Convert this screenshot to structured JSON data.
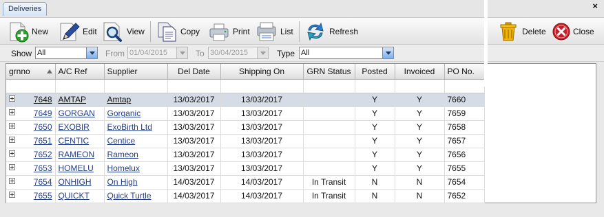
{
  "tab": {
    "label": "Deliveries",
    "close": "×"
  },
  "toolbar": {
    "new_label": "New",
    "edit_label": "Edit",
    "view_label": "View",
    "copy_label": "Copy",
    "print_label": "Print",
    "list_label": "List",
    "refresh_label": "Refresh",
    "delete_label": "Delete",
    "close_label": "Close"
  },
  "filters": {
    "show_label": "Show",
    "show_value": "All",
    "from_label": "From",
    "from_value": "01/04/2015",
    "to_label": "To",
    "to_value": "30/04/2015",
    "type_label": "Type",
    "type_value": "All"
  },
  "grid": {
    "columns": {
      "grnno": "grnno",
      "ac_ref": "A/C Ref",
      "supplier": "Supplier",
      "del_date": "Del Date",
      "shipping_on": "Shipping On",
      "grn_status": "GRN Status",
      "posted": "Posted",
      "invoiced": "Invoiced",
      "po_no": "PO No."
    },
    "rows": [
      {
        "grnno": "7648",
        "ac_ref": "AMTAP",
        "supplier": "Amtap",
        "del_date": "13/03/2017",
        "shipping_on": "13/03/2017",
        "grn_status": "",
        "posted": "Y",
        "invoiced": "Y",
        "po_no": "7660"
      },
      {
        "grnno": "7649",
        "ac_ref": "GORGAN",
        "supplier": "Gorganic",
        "del_date": "13/03/2017",
        "shipping_on": "13/03/2017",
        "grn_status": "",
        "posted": "Y",
        "invoiced": "Y",
        "po_no": "7659"
      },
      {
        "grnno": "7650",
        "ac_ref": "EXOBIR",
        "supplier": "ExoBirth Ltd",
        "del_date": "13/03/2017",
        "shipping_on": "13/03/2017",
        "grn_status": "",
        "posted": "Y",
        "invoiced": "Y",
        "po_no": "7658"
      },
      {
        "grnno": "7651",
        "ac_ref": "CENTIC",
        "supplier": "Centice",
        "del_date": "13/03/2017",
        "shipping_on": "13/03/2017",
        "grn_status": "",
        "posted": "Y",
        "invoiced": "Y",
        "po_no": "7657"
      },
      {
        "grnno": "7652",
        "ac_ref": "RAMEON",
        "supplier": "Rameon",
        "del_date": "13/03/2017",
        "shipping_on": "13/03/2017",
        "grn_status": "",
        "posted": "Y",
        "invoiced": "Y",
        "po_no": "7656"
      },
      {
        "grnno": "7653",
        "ac_ref": "HOMELU",
        "supplier": "Homelux",
        "del_date": "13/03/2017",
        "shipping_on": "13/03/2017",
        "grn_status": "",
        "posted": "Y",
        "invoiced": "Y",
        "po_no": "7655"
      },
      {
        "grnno": "7654",
        "ac_ref": "ONHIGH",
        "supplier": "On High",
        "del_date": "14/03/2017",
        "shipping_on": "14/03/2017",
        "grn_status": "In Transit",
        "posted": "N",
        "invoiced": "N",
        "po_no": "7654"
      },
      {
        "grnno": "7655",
        "ac_ref": "QUICKT",
        "supplier": "Quick Turtle",
        "del_date": "14/03/2017",
        "shipping_on": "14/03/2017",
        "grn_status": "In Transit",
        "posted": "N",
        "invoiced": "N",
        "po_no": "7652"
      }
    ]
  },
  "colors": {
    "selected_row": "#d6dce6",
    "link": "#233e8a",
    "combo_button": "#7faee8",
    "close_icon": "#c8202a",
    "delete_icon": "#f0b400"
  },
  "icons": {
    "new": "document-plus-icon",
    "edit": "pencil-icon",
    "view": "magnifier-icon",
    "copy": "copy-documents-icon",
    "print": "printer-icon",
    "list": "list-printer-icon",
    "refresh": "refresh-arrows-icon",
    "delete": "trash-bin-icon",
    "close": "close-circle-icon",
    "expand": "plus-box-icon",
    "sort": "sort-ascending-icon"
  }
}
